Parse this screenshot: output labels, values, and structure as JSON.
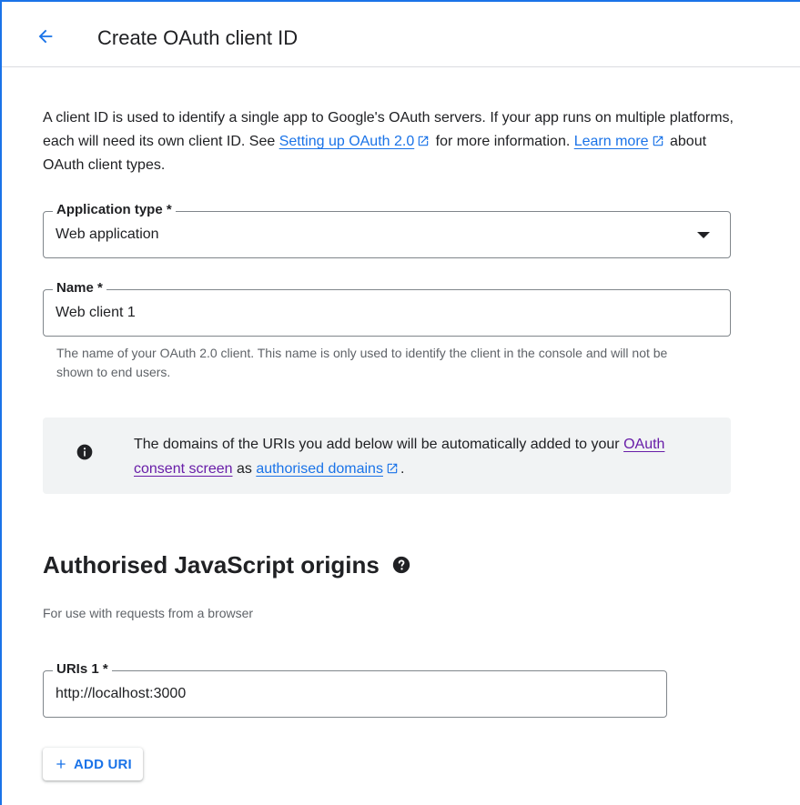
{
  "header": {
    "title": "Create OAuth client ID"
  },
  "intro": {
    "text_1": "A client ID is used to identify a single app to Google's OAuth servers. If your app runs on multiple platforms, each will need its own client ID. See ",
    "link_setup": "Setting up OAuth 2.0",
    "text_2": " for more information. ",
    "link_learn": "Learn more",
    "text_3": " about OAuth client types."
  },
  "application_type": {
    "label": "Application type *",
    "value": "Web application"
  },
  "name_field": {
    "label": "Name *",
    "value": "Web client 1",
    "helper": "The name of your OAuth 2.0 client. This name is only used to identify the client in the console and will not be shown to end users."
  },
  "notice": {
    "text_1": "The domains of the URIs you add below will be automatically added to your ",
    "link_consent": "OAuth consent screen",
    "text_2": " as ",
    "link_domains": "authorised domains",
    "text_3": "."
  },
  "js_origins": {
    "title": "Authorised JavaScript origins",
    "subtitle": "For use with requests from a browser",
    "uri_label": "URIs 1 *",
    "uri_value": "http://localhost:3000",
    "add_button": "ADD URI"
  },
  "icons": {
    "back": "arrow-back-icon",
    "external": "open-in-new-icon",
    "info": "info-icon",
    "help": "help-icon",
    "add": "plus-icon",
    "dropdown": "caret-down-icon"
  },
  "colors": {
    "accent": "#1a73e8",
    "visited_link": "#681da8",
    "notice_bg": "#f1f3f4"
  }
}
